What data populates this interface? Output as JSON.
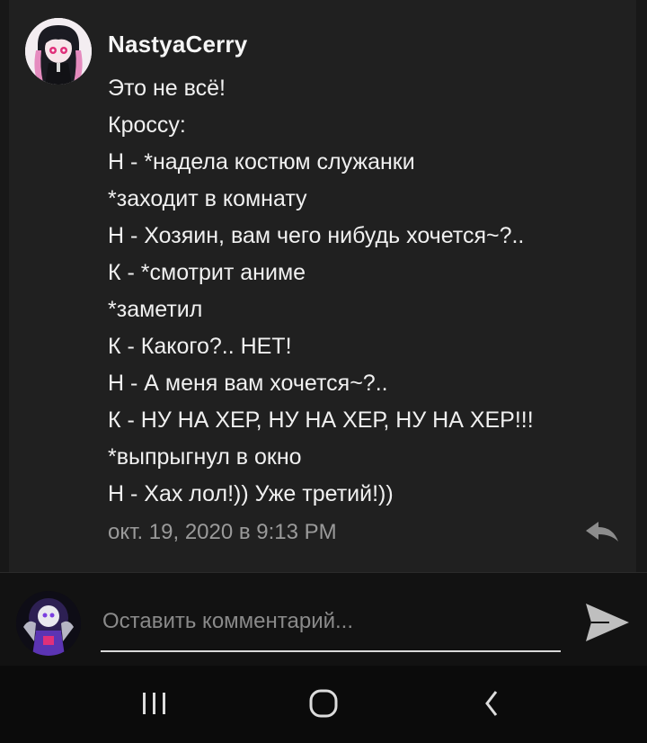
{
  "comment": {
    "author": "NastyaCerry",
    "lines": [
      "Это не всё!",
      "Кроссу:",
      "Н - *надела костюм служанки",
      "*заходит в комнату",
      "Н - Хозяин, вам чего нибудь хочется~?..",
      "К - *смотрит аниме",
      "*заметил",
      "К - Какого?.. НЕТ!",
      "Н - А меня вам хочется~?..",
      "К - НУ НА ХЕР, НУ НА ХЕР, НУ НА ХЕР!!!",
      "*выпрыгнул в окно",
      "Н - Хах лол!)) Уже третий!))"
    ],
    "timestamp": "окт. 19, 2020 в 9:13 PM",
    "reply_icon": "reply-icon"
  },
  "composer": {
    "placeholder": "Оставить комментарий...",
    "send_icon": "send-icon"
  },
  "nav": {
    "recents_icon": "recents-icon",
    "home_icon": "home-icon",
    "back_icon": "back-icon"
  },
  "colors": {
    "card_bg": "#202020",
    "page_bg": "#0f0f0f",
    "muted_text": "#9a9a9a"
  }
}
